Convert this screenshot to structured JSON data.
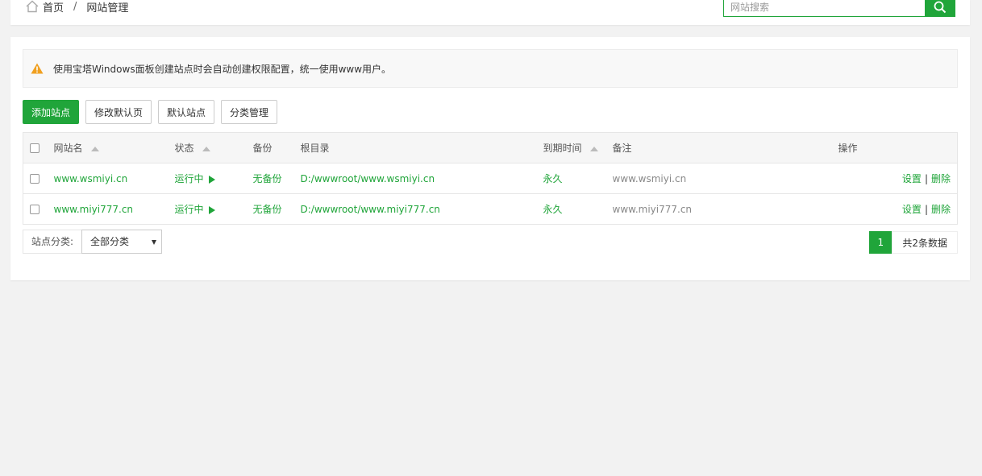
{
  "breadcrumb": {
    "home": "首页",
    "separator": "/",
    "current": "网站管理"
  },
  "search": {
    "placeholder": "网站搜索",
    "icon": "search-icon"
  },
  "notice": {
    "text": "使用宝塔Windows面板创建站点时会自动创建权限配置，统一使用www用户。",
    "icon": "warning-icon"
  },
  "toolbar": {
    "add_site": "添加站点",
    "edit_default_page": "修改默认页",
    "default_site": "默认站点",
    "category_manage": "分类管理"
  },
  "table": {
    "headers": {
      "name": "网站名",
      "status": "状态",
      "backup": "备份",
      "root": "根目录",
      "expire": "到期时间",
      "remark": "备注",
      "actions": "操作"
    },
    "rows": [
      {
        "name": "www.wsmiyi.cn",
        "status": "运行中",
        "backup": "无备份",
        "root": "D:/wwwroot/www.wsmiyi.cn",
        "expire": "永久",
        "remark": "www.wsmiyi.cn",
        "settings": "设置",
        "delete": "删除"
      },
      {
        "name": "www.miyi777.cn",
        "status": "运行中",
        "backup": "无备份",
        "root": "D:/wwwroot/www.miyi777.cn",
        "expire": "永久",
        "remark": "www.miyi777.cn",
        "settings": "设置",
        "delete": "删除"
      }
    ]
  },
  "footer": {
    "category_label": "站点分类:",
    "category_selected": "全部分类",
    "current_page": "1",
    "total_text": "共2条数据"
  },
  "colors": {
    "accent": "#20a53a",
    "warning": "#f0a020"
  }
}
